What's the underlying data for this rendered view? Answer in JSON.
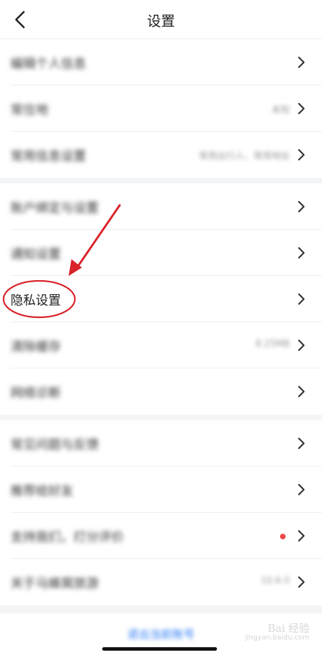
{
  "header": {
    "title": "设置",
    "back_icon": "chevron-left-icon"
  },
  "sections": [
    {
      "items": [
        {
          "label": "编辑个人信息",
          "value": "",
          "blurred": true
        },
        {
          "label": "常住地",
          "value": "未知",
          "blurred": true
        },
        {
          "label": "常用信息设置",
          "value": "常用出行人、常用地址",
          "blurred": true
        }
      ]
    },
    {
      "items": [
        {
          "label": "账户绑定与设置",
          "value": "",
          "blurred": true
        },
        {
          "label": "通知设置",
          "value": "",
          "blurred": true
        },
        {
          "label": "隐私设置",
          "value": "",
          "blurred": false,
          "highlighted": true
        },
        {
          "label": "清除缓存",
          "value": "8.25MB",
          "blurred": true
        },
        {
          "label": "网络诊断",
          "value": "",
          "blurred": true
        }
      ]
    },
    {
      "items": [
        {
          "label": "常见问题与反馈",
          "value": "",
          "blurred": true
        },
        {
          "label": "推荐给好友",
          "value": "",
          "blurred": true
        },
        {
          "label": "支持我们，打分评价",
          "value": "",
          "blurred": true,
          "red_dot": true
        },
        {
          "label": "关于马蜂窝旅游",
          "value": "10.6.0",
          "blurred": true
        }
      ]
    }
  ],
  "logout": {
    "label": "退出当前账号"
  },
  "annotation": {
    "color": "#d9232a",
    "target": "隐私设置"
  },
  "watermark": {
    "brand": "Bai 经验",
    "url": "jingyan.baidu.com"
  }
}
